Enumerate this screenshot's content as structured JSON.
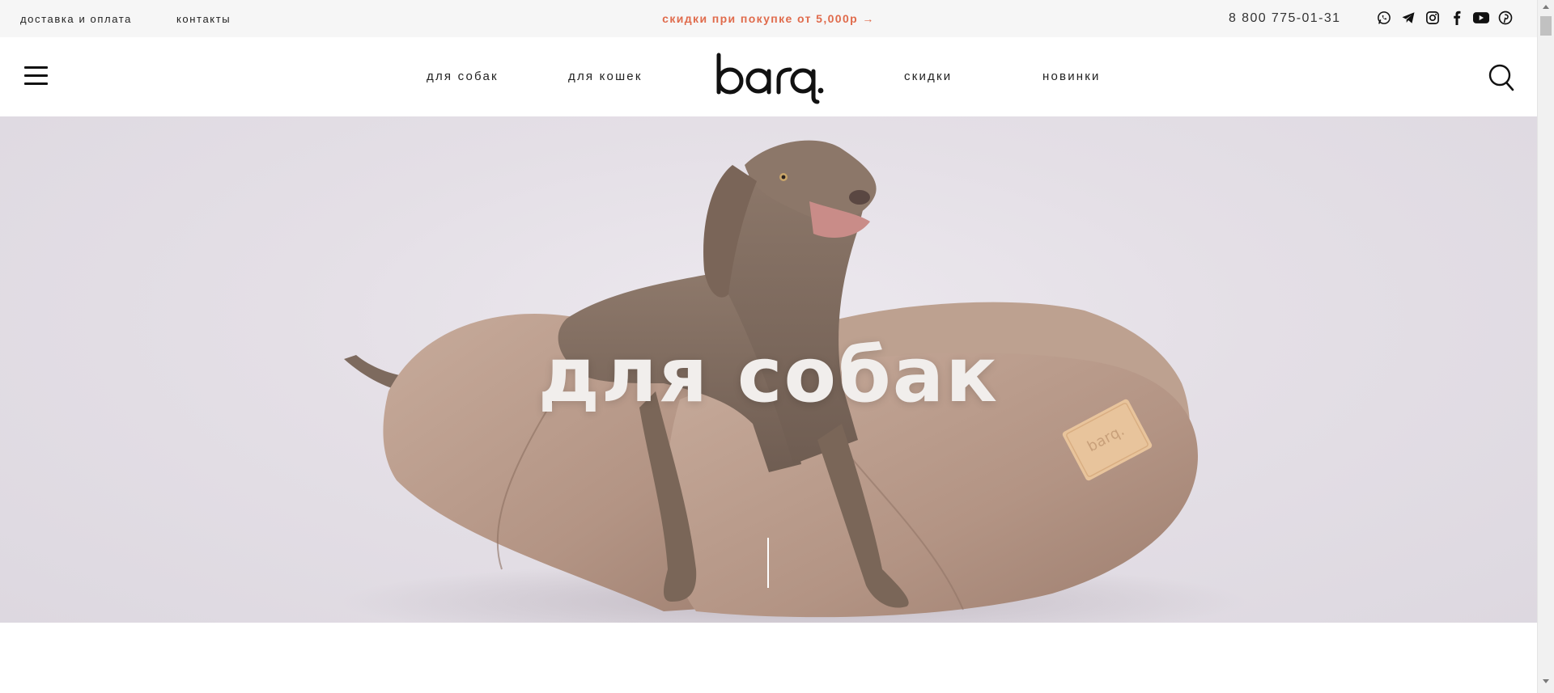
{
  "topbar": {
    "delivery_link": "доставка и оплата",
    "contacts_link": "контакты",
    "promo": "скидки при покупке от 5,000р →",
    "phone": "8 800 775-01-31",
    "socials": [
      "whatsapp-icon",
      "telegram-icon",
      "instagram-icon",
      "facebook-icon",
      "youtube-icon",
      "pinterest-icon"
    ]
  },
  "header": {
    "menu_icon": "hamburger-menu-icon",
    "nav": {
      "dogs": "для собак",
      "cats": "для кошек",
      "sale": "скидки",
      "new": "новинки"
    },
    "logo": "barq.",
    "search_icon": "search-icon"
  },
  "hero": {
    "title": "для собак",
    "pillow_tag": "barq."
  },
  "colors": {
    "promo": "#e06b4c",
    "hero_background": "#e4dfe6",
    "pillow": "#b89a8a",
    "dog": "#8a7568",
    "tag": "#e8c49c"
  }
}
